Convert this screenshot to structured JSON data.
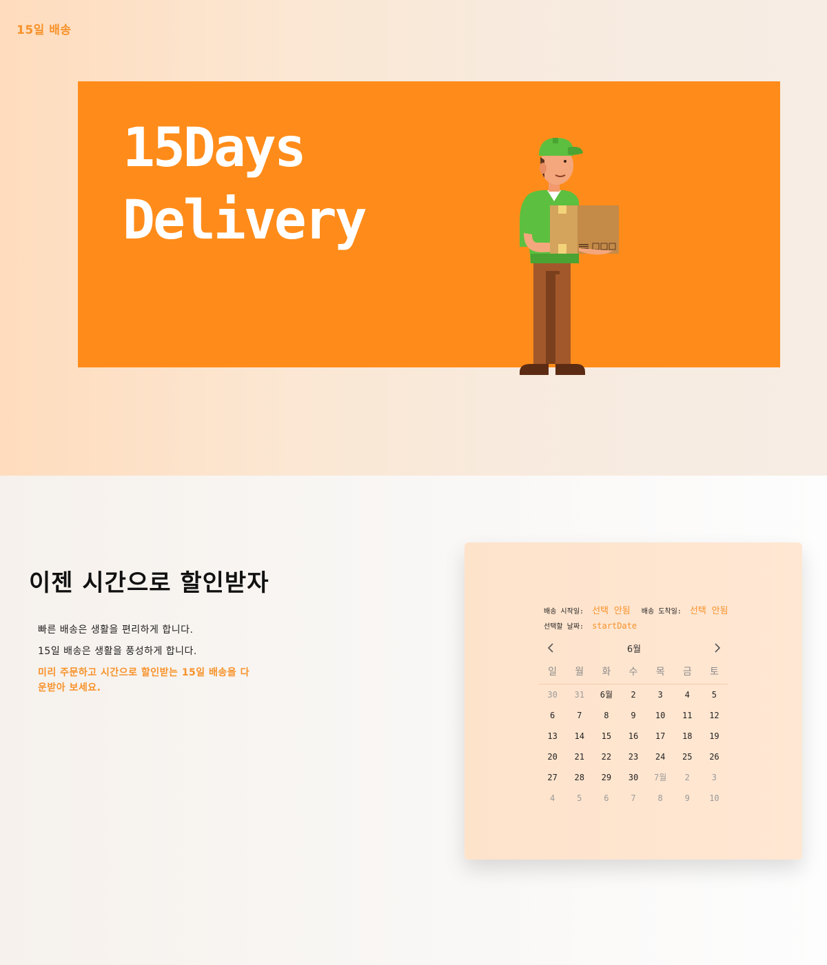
{
  "header": {
    "logo": "15일 배송"
  },
  "banner": {
    "title_line1": "15Days",
    "title_line2": "Delivery",
    "illustration": "delivery-courier-holding-box"
  },
  "intro": {
    "headline": "이젠 시간으로 할인받자",
    "line1": "빠른 배송은 생활을 편리하게 합니다.",
    "line2": "15일 배송은 생활을 풍성하게 합니다.",
    "highlight": "미리 주문하고 시간으로 할인받는 15일 배송을 다운받아 보세요."
  },
  "calendar": {
    "start_label": "배송 시작일:",
    "start_value": "선택 안됨",
    "end_label": "배송 도착일:",
    "end_value": "선택 안됨",
    "selected_label": "선택할 날짜:",
    "selected_value": "startDate",
    "month": "6월",
    "prev_icon": "chevron-left-icon",
    "next_icon": "chevron-right-icon",
    "weekdays": [
      "일",
      "월",
      "화",
      "수",
      "목",
      "금",
      "토"
    ],
    "days": [
      {
        "label": "30",
        "current": false
      },
      {
        "label": "31",
        "current": false
      },
      {
        "label": "6월",
        "current": true
      },
      {
        "label": "2",
        "current": true
      },
      {
        "label": "3",
        "current": true
      },
      {
        "label": "4",
        "current": true
      },
      {
        "label": "5",
        "current": true
      },
      {
        "label": "6",
        "current": true
      },
      {
        "label": "7",
        "current": true
      },
      {
        "label": "8",
        "current": true
      },
      {
        "label": "9",
        "current": true
      },
      {
        "label": "10",
        "current": true
      },
      {
        "label": "11",
        "current": true
      },
      {
        "label": "12",
        "current": true
      },
      {
        "label": "13",
        "current": true
      },
      {
        "label": "14",
        "current": true
      },
      {
        "label": "15",
        "current": true
      },
      {
        "label": "16",
        "current": true
      },
      {
        "label": "17",
        "current": true
      },
      {
        "label": "18",
        "current": true
      },
      {
        "label": "19",
        "current": true
      },
      {
        "label": "20",
        "current": true
      },
      {
        "label": "21",
        "current": true
      },
      {
        "label": "22",
        "current": true
      },
      {
        "label": "23",
        "current": true
      },
      {
        "label": "24",
        "current": true
      },
      {
        "label": "25",
        "current": true
      },
      {
        "label": "26",
        "current": true
      },
      {
        "label": "27",
        "current": true
      },
      {
        "label": "28",
        "current": true
      },
      {
        "label": "29",
        "current": true
      },
      {
        "label": "30",
        "current": true
      },
      {
        "label": "7월",
        "current": false
      },
      {
        "label": "2",
        "current": false
      },
      {
        "label": "3",
        "current": false
      },
      {
        "label": "4",
        "current": false
      },
      {
        "label": "5",
        "current": false
      },
      {
        "label": "6",
        "current": false
      },
      {
        "label": "7",
        "current": false
      },
      {
        "label": "8",
        "current": false
      },
      {
        "label": "9",
        "current": false
      },
      {
        "label": "10",
        "current": false
      }
    ]
  },
  "colors": {
    "accent": "#f7922a",
    "banner": "#ff8c1a",
    "card": "#ffe5cf"
  }
}
